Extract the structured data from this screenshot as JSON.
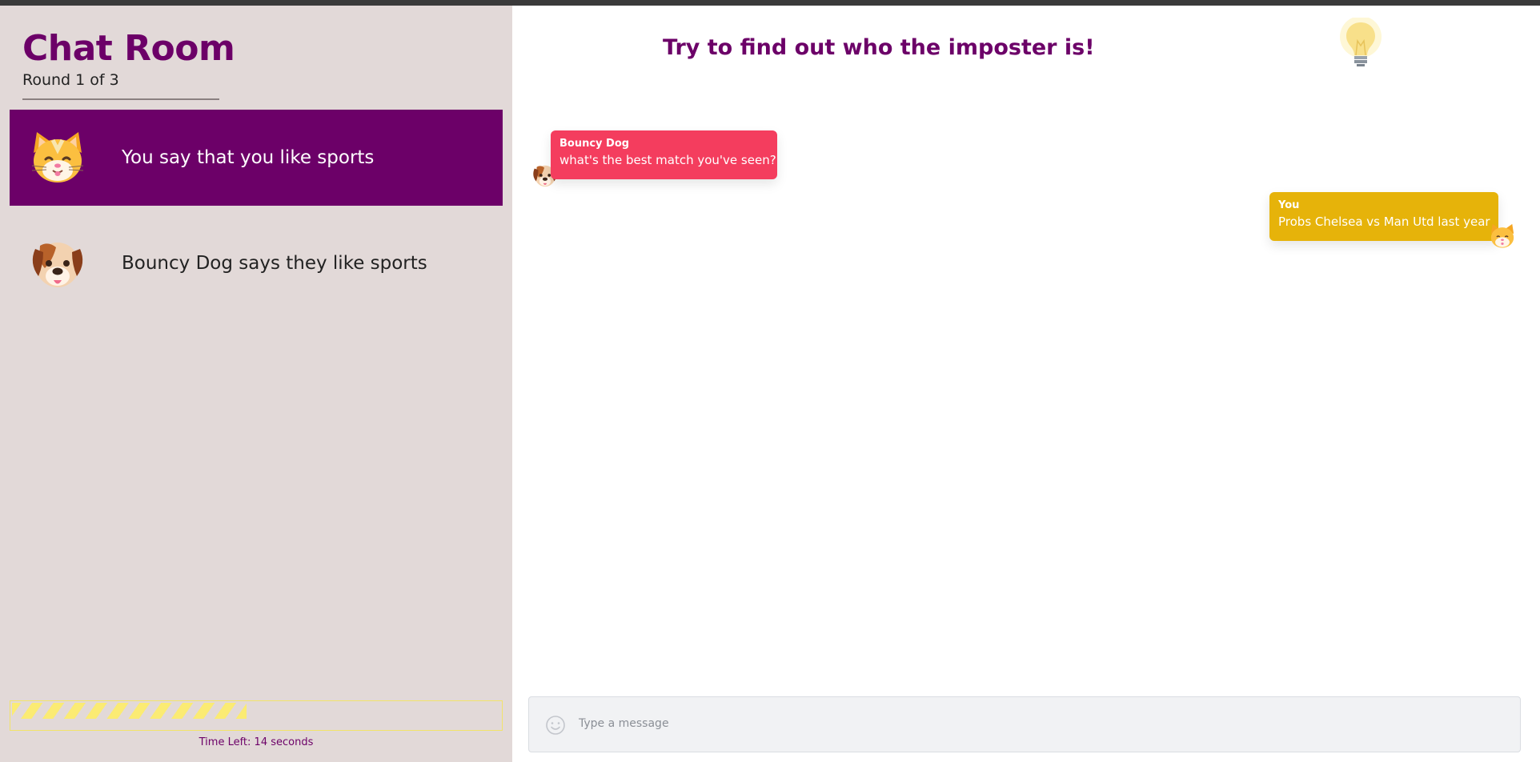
{
  "sidebar": {
    "title": "Chat Room",
    "round": "Round 1 of 3",
    "players": [
      {
        "avatar": "cat-face-icon",
        "claim": "You say that you like sports",
        "active": true
      },
      {
        "avatar": "dog-face-icon",
        "claim": "Bouncy Dog says they like sports",
        "active": false
      }
    ],
    "timer": {
      "text": "Time Left: 14 seconds",
      "remaining_fraction": 0.48
    }
  },
  "chat": {
    "headline": "Try to find out who the imposter is!",
    "hint_icon": "lightbulb-icon",
    "messages": [
      {
        "sender": "Bouncy Dog",
        "text": "what's the best match you've seen?",
        "avatar": "dog-face-icon",
        "color": "#f43d5e"
      },
      {
        "sender": "You",
        "text": "Probs Chelsea vs Man Utd last year",
        "avatar": "cat-face-icon",
        "color": "#e6b30a"
      }
    ],
    "input": {
      "placeholder": "Type a message",
      "emoji_icon": "smiley-icon"
    }
  },
  "colors": {
    "accent": "#6c0068",
    "sidebar_bg": "#e2d9d8",
    "timer_stripe": "#fbeb73"
  }
}
